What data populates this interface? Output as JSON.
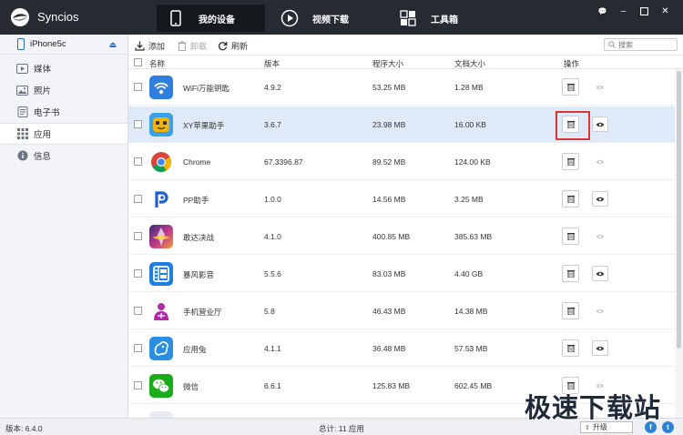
{
  "app": {
    "name": "Syncios",
    "logo_icon": "syncios-logo-icon"
  },
  "nav_tabs": [
    {
      "label": "我的设备",
      "icon": "phone-icon",
      "active": true
    },
    {
      "label": "视频下载",
      "icon": "play-icon",
      "active": false
    },
    {
      "label": "工具箱",
      "icon": "toolbox-icon",
      "active": false
    }
  ],
  "window_buttons": {
    "menu": "💬",
    "minimize": "–",
    "restore": "▫",
    "close": "✕"
  },
  "device": {
    "name": "iPhone5c"
  },
  "sidebar": {
    "items": [
      {
        "label": "媒体",
        "icon": "media-icon"
      },
      {
        "label": "照片",
        "icon": "photo-icon"
      },
      {
        "label": "电子书",
        "icon": "ebook-icon"
      },
      {
        "label": "应用",
        "icon": "apps-icon",
        "active": true
      },
      {
        "label": "信息",
        "icon": "info-icon"
      }
    ]
  },
  "toolbar": {
    "add_label": "添加",
    "uninstall_label": "卸载",
    "refresh_label": "刷新",
    "search_placeholder": "搜索"
  },
  "table": {
    "headers": {
      "name": "名称",
      "version": "版本",
      "app_size": "程序大小",
      "doc_size": "文档大小",
      "action": "操作"
    },
    "rows": [
      {
        "name": "WiFi万能钥匙",
        "version": "4.9.2",
        "app_size": "53.25 MB",
        "doc_size": "1.28 MB",
        "icon": "wifi-key-app-icon",
        "view_enabled": false
      },
      {
        "name": "XY苹果助手",
        "version": "3.6.7",
        "app_size": "23.98 MB",
        "doc_size": "16.00 KB",
        "icon": "xy-assistant-app-icon",
        "view_enabled": true,
        "selected": true
      },
      {
        "name": "Chrome",
        "version": "67.3396.87",
        "app_size": "89.52 MB",
        "doc_size": "124.00 KB",
        "icon": "chrome-app-icon",
        "view_enabled": false
      },
      {
        "name": "PP助手",
        "version": "1.0.0",
        "app_size": "14.56 MB",
        "doc_size": "3.25 MB",
        "icon": "pp-assistant-app-icon",
        "view_enabled": true
      },
      {
        "name": "敢达决战",
        "version": "4.1.0",
        "app_size": "400.85 MB",
        "doc_size": "385.63 MB",
        "icon": "gundam-app-icon",
        "view_enabled": false
      },
      {
        "name": "暴风影音",
        "version": "5.5.6",
        "app_size": "83.03 MB",
        "doc_size": "4.40 GB",
        "icon": "baofeng-app-icon",
        "view_enabled": true
      },
      {
        "name": "手机营业厅",
        "version": "5.8",
        "app_size": "46.43 MB",
        "doc_size": "14.38 MB",
        "icon": "unicom-app-icon",
        "view_enabled": false
      },
      {
        "name": "应用兔",
        "version": "4.1.1",
        "app_size": "36.48 MB",
        "doc_size": "57.53 MB",
        "icon": "yingyongtu-app-icon",
        "view_enabled": true
      },
      {
        "name": "微信",
        "version": "6.6.1",
        "app_size": "125.83 MB",
        "doc_size": "602.45 MB",
        "icon": "wechat-app-icon",
        "view_enabled": false
      }
    ]
  },
  "status": {
    "version": "版本: 6.4.0",
    "total": "总计: 11 应用",
    "upgrade_label": "升级"
  },
  "social": {
    "facebook": "f",
    "twitter": "t"
  },
  "watermark": "极速下载站",
  "colors": {
    "titlebar": "#262a31",
    "selected_row": "#dfeaf8",
    "highlight": "#d93636",
    "accent": "#2d6ac8"
  }
}
